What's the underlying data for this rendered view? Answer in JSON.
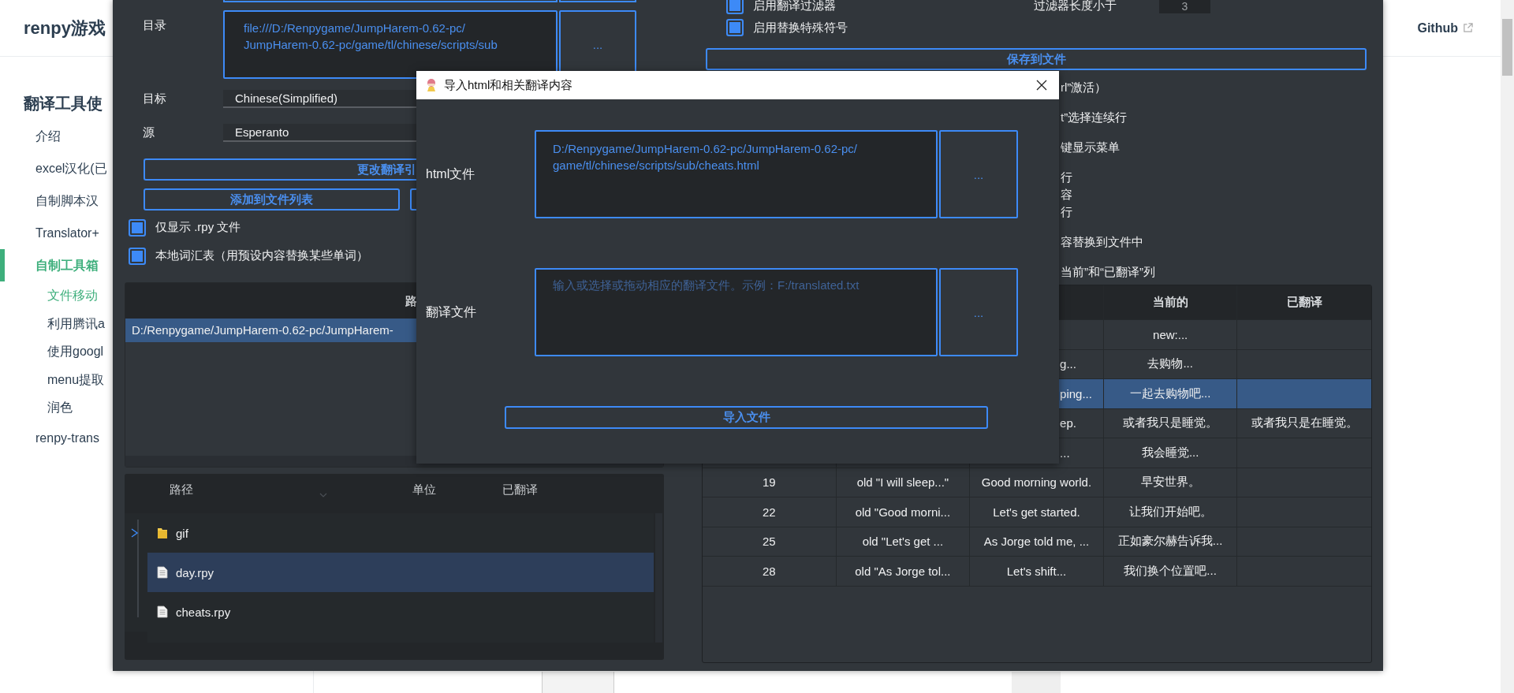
{
  "page": {
    "site_title": "renpy游戏",
    "header_links": [
      {
        "label": "Github"
      }
    ],
    "sidebar": {
      "section_title": "翻译工具使",
      "items": [
        {
          "label": "介绍",
          "selected": false
        },
        {
          "label": "excel汉化(已",
          "selected": false
        },
        {
          "label": "自制脚本汉",
          "selected": false
        },
        {
          "label": "Translator+",
          "selected": false
        },
        {
          "label": "自制工具箱",
          "selected": true,
          "children": [
            {
              "label": "文件移动",
              "selected": true
            },
            {
              "label": "利用腾讯a",
              "selected": false
            },
            {
              "label": "使用googl",
              "selected": false
            },
            {
              "label": "menu提取",
              "selected": false
            },
            {
              "label": "润色",
              "selected": false
            }
          ]
        },
        {
          "label": "renpy-trans",
          "selected": false
        }
      ]
    }
  },
  "app": {
    "directory": {
      "label": "目录",
      "value": "file:///D:/Renpygame/JumpHarem-0.62-pc/\nJumpHarem-0.62-pc/game/tl/chinese/scripts/sub",
      "button": "..."
    },
    "target": {
      "label": "目标",
      "value": "Chinese(Simplified)"
    },
    "source": {
      "label": "源",
      "value": "Esperanto"
    },
    "engine_button": "更改翻译引",
    "add_button": "添加到文件列表",
    "options": [
      {
        "label": "仅显示 .rpy 文件",
        "checked": true
      },
      {
        "label": "本地词汇表（用预设内容替换某些单词）",
        "checked": true
      }
    ],
    "file_list": {
      "header": "路",
      "rows": [
        {
          "path": "D:/Renpygame/JumpHarem-0.62-pc/JumpHarem-",
          "selected": true
        }
      ]
    },
    "tree": {
      "columns": [
        "路径",
        "单位",
        "已翻译"
      ],
      "items": [
        {
          "name": "gif",
          "kind": "folder",
          "expanded": false,
          "selected": false
        },
        {
          "name": "day.rpy",
          "kind": "file",
          "selected": true
        },
        {
          "name": "cheats.rpy",
          "kind": "file",
          "selected": false
        }
      ]
    },
    "filters": [
      {
        "label": "启用翻译过滤器",
        "checked": true
      },
      {
        "label": "启用替换特殊符号",
        "checked": true
      }
    ],
    "filter_length": {
      "label": "过滤器长度小于",
      "value": "3"
    },
    "save_button": "保存到文件",
    "hints": [
      "rl”激活）",
      "t”选择连续行",
      "键显示菜单",
      "行",
      "容",
      "行",
      "容替换到文件中",
      "当前”和“已翻译”列"
    ],
    "table": {
      "columns": {
        "column_4": "当前的",
        "column_5": "已翻译"
      },
      "rows": [
        {
          "cells": {
            "column_4": "new:..."
          },
          "selected": false
        },
        {
          "cells": {
            "column_3": "g...",
            "column_4": "去购物..."
          },
          "selected": false
        },
        {
          "cells": {
            "column_3": "ping...",
            "column_4": "一起去购物吧..."
          },
          "selected": true
        },
        {
          "cells": {
            "column_3": "ep.",
            "column_4": "或者我只是睡觉。",
            "column_5": "或者我只是在睡觉。"
          },
          "selected": false
        },
        {
          "cells": {
            "column_3": "...",
            "column_4": "我会睡觉..."
          },
          "selected": false
        },
        {
          "cells": {
            "column_1": "19",
            "column_2": "old \"I will sleep...\"",
            "column_3": "Good morning world.",
            "column_4": "早安世界。"
          },
          "selected": false
        },
        {
          "cells": {
            "column_1": "22",
            "column_2": "old \"Good morni...",
            "column_3": "Let's get started.",
            "column_4": "让我们开始吧。"
          },
          "selected": false
        },
        {
          "cells": {
            "column_1": "25",
            "column_2": "old \"Let's get ...",
            "column_3": "As Jorge told me, ...",
            "column_4": "正如豪尔赫告诉我..."
          },
          "selected": false
        },
        {
          "cells": {
            "column_1": "28",
            "column_2": "old \"As Jorge tol...",
            "column_3": "Let's shift...",
            "column_4": "我们换个位置吧..."
          },
          "selected": false
        }
      ]
    }
  },
  "dialog": {
    "title": "导入html和相关翻译内容",
    "fields": [
      {
        "label": "html文件",
        "value": "D:/Renpygame/JumpHarem-0.62-pc/JumpHarem-0.62-pc/\ngame/tl/chinese/scripts/sub/cheats.html",
        "button": "..."
      },
      {
        "label": "翻译文件",
        "placeholder": "输入或选择或拖动相应的翻译文件。示例：F:/translated.txt",
        "button": "..."
      }
    ],
    "submit": "导入文件"
  }
}
